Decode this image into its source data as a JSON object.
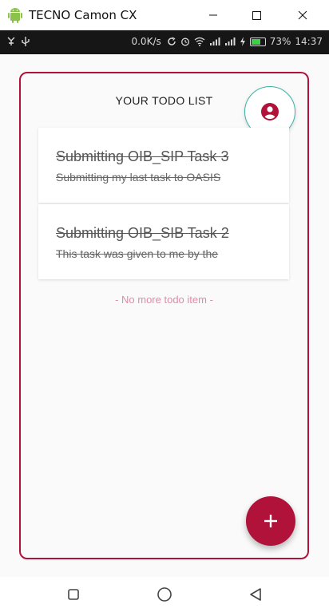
{
  "window": {
    "title": "TECNO Camon CX",
    "app_icon": "android-icon",
    "controls": [
      "minimize-icon",
      "maximize-icon",
      "close-icon"
    ]
  },
  "status_bar": {
    "net_speed": "0.0K/s",
    "battery_percent": "73%",
    "battery_level": 0.73,
    "time": "14:37",
    "icons": [
      "usb-debug-icon",
      "usb-icon",
      "sync-icon",
      "alarm-icon",
      "wifi-icon",
      "signal-icon",
      "signal-icon",
      "charging-icon",
      "battery-icon"
    ],
    "battery_color": "#3ecf4a"
  },
  "app": {
    "header": "YOUR TODO LIST",
    "accent_color": "#b0123a",
    "todos": [
      {
        "title": "Submitting OIB_SIP Task 3",
        "description": "Submitting my last task to OASIS",
        "completed": true
      },
      {
        "title": "Submitting OIB_SIB Task 2",
        "description": "This task was given to me by the",
        "completed": true
      }
    ],
    "empty_footer": "- No more todo item -",
    "add_button_icon": "plus-icon",
    "profile_button_icon": "account-circle-icon"
  },
  "nav_bar": {
    "buttons": [
      "recents-icon",
      "home-icon",
      "back-icon"
    ]
  }
}
